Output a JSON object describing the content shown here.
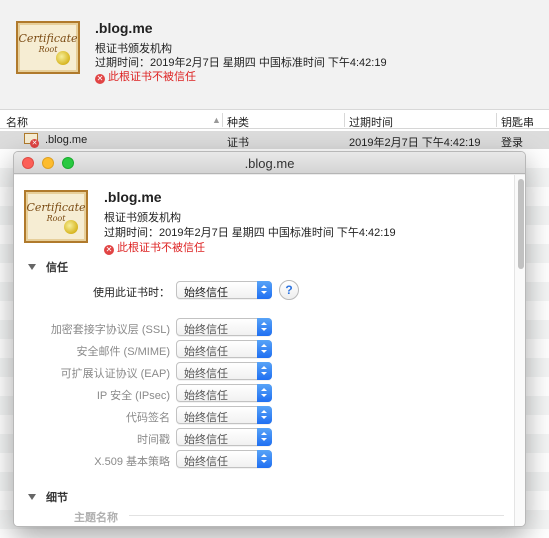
{
  "background": {
    "header": {
      "title": ".blog.me",
      "subtitle": "根证书颁发机构",
      "expiry": "过期时间：2019年2月7日 星期四 中国标准时间 下午4:42:19",
      "warning": "此根证书不被信任",
      "icon_text_1": "Certificate",
      "icon_text_2": "Root"
    },
    "columns": [
      "名称",
      "种类",
      "过期时间",
      "钥匙串"
    ],
    "row": {
      "name": ".blog.me",
      "kind": "证书",
      "expires": "2019年2月7日 下午4:42:19",
      "keychain": "登录"
    }
  },
  "window": {
    "title": ".blog.me",
    "header": {
      "title": ".blog.me",
      "subtitle": "根证书颁发机构",
      "expiry": "过期时间：2019年2月7日 星期四 中国标准时间 下午4:42:19",
      "warning": "此根证书不被信任",
      "icon_text_1": "Certificate",
      "icon_text_2": "Root"
    },
    "trust": {
      "section_label": "信任",
      "when_using_label": "使用此证书时：",
      "when_using_value": "始终信任",
      "help": "?",
      "items": [
        {
          "label": "加密套接字协议层 (SSL)",
          "value": "始终信任"
        },
        {
          "label": "安全邮件 (S/MIME)",
          "value": "始终信任"
        },
        {
          "label": "可扩展认证协议 (EAP)",
          "value": "始终信任"
        },
        {
          "label": "IP 安全 (IPsec)",
          "value": "始终信任"
        },
        {
          "label": "代码签名",
          "value": "始终信任"
        },
        {
          "label": "时间戳",
          "value": "始终信任"
        },
        {
          "label": "X.509 基本策略",
          "value": "始终信任"
        }
      ]
    },
    "details": {
      "section_label": "细节",
      "first_field": "主题名称"
    }
  },
  "colors": {
    "warning": "#dd2222",
    "accent": "#1f6ff2"
  }
}
